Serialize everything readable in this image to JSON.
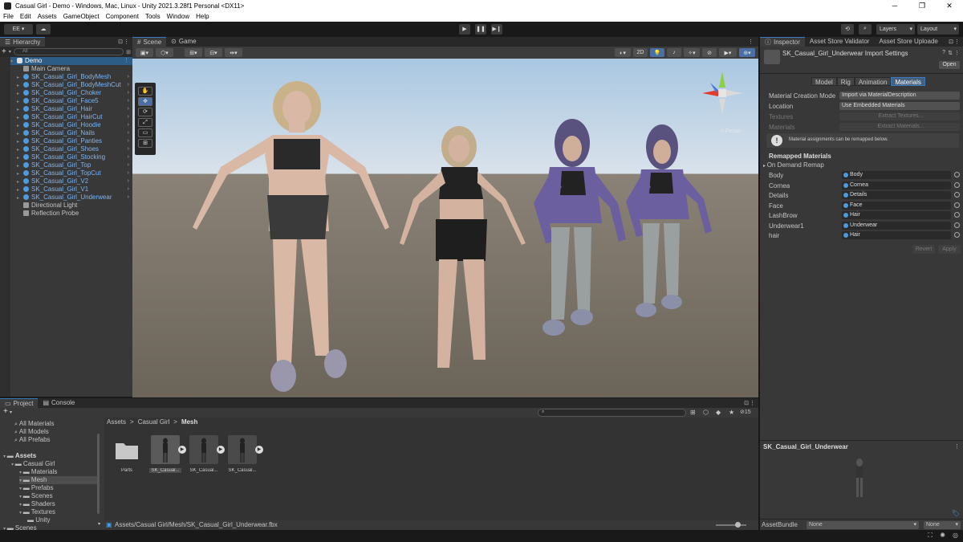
{
  "window": {
    "title": "Casual Girl - Demo - Windows, Mac, Linux - Unity 2021.3.28f1 Personal <DX11>",
    "controls": [
      "─",
      "❐",
      "✕"
    ]
  },
  "menu": [
    "File",
    "Edit",
    "Assets",
    "GameObject",
    "Component",
    "Tools",
    "Window",
    "Help"
  ],
  "toolbar": {
    "account": "EE ▾",
    "play": "▶",
    "pause": "❚❚",
    "step": "▶❙",
    "layers": "Layers",
    "layout": "Layout"
  },
  "hierarchy": {
    "tab": "Hierarchy",
    "search_placeholder": "All",
    "scene": "Demo",
    "items": [
      {
        "label": "Main Camera",
        "blue": false,
        "expand": false
      },
      {
        "label": "SK_Casual_Girl_BodyMesh",
        "blue": true,
        "expand": true
      },
      {
        "label": "SK_Casual_Girl_BodyMeshCut",
        "blue": true,
        "expand": true
      },
      {
        "label": "SK_Casual_Girl_Choker",
        "blue": true,
        "expand": true
      },
      {
        "label": "SK_Casual_Girl_Face5",
        "blue": true,
        "expand": true
      },
      {
        "label": "SK_Casual_Girl_Hair",
        "blue": true,
        "expand": true
      },
      {
        "label": "SK_Casual_Girl_HairCut",
        "blue": true,
        "expand": true
      },
      {
        "label": "SK_Casual_Girl_Hoodie",
        "blue": true,
        "expand": true
      },
      {
        "label": "SK_Casual_Girl_Nails",
        "blue": true,
        "expand": true
      },
      {
        "label": "SK_Casual_Girl_Panties",
        "blue": true,
        "expand": true
      },
      {
        "label": "SK_Casual_Girl_Shoes",
        "blue": true,
        "expand": true
      },
      {
        "label": "SK_Casual_Girl_Stocking",
        "blue": true,
        "expand": true
      },
      {
        "label": "SK_Casual_Girl_Top",
        "blue": true,
        "expand": true
      },
      {
        "label": "SK_Casual_Girl_TopCut",
        "blue": true,
        "expand": true
      },
      {
        "label": "SK_Casual_Girl_V2",
        "blue": true,
        "expand": true
      },
      {
        "label": "SK_Casual_Girl_V1",
        "blue": true,
        "expand": true
      },
      {
        "label": "SK_Casual_Girl_Underwear",
        "blue": true,
        "expand": true
      },
      {
        "label": "Directional Light",
        "blue": false,
        "expand": false
      },
      {
        "label": "Reflection Probe",
        "blue": false,
        "expand": false
      }
    ]
  },
  "scene": {
    "tabs": [
      "Scene",
      "Game"
    ],
    "mode_2d": "2D",
    "persp": "< Persp"
  },
  "inspector": {
    "tabs": [
      "Inspector",
      "Asset Store Validator",
      "Asset Store Uploade"
    ],
    "title": "SK_Casual_Girl_Underwear Import Settings",
    "open": "Open",
    "subtabs": [
      "Model",
      "Rig",
      "Animation",
      "Materials"
    ],
    "fields": [
      {
        "k": "Material Creation Mode",
        "v": "Import via MaterialDescription",
        "dim": false
      },
      {
        "k": "Location",
        "v": "Use Embedded Materials",
        "dim": false
      },
      {
        "k": "Textures",
        "v": "Extract Textures...",
        "dim": true
      },
      {
        "k": "Materials",
        "v": "Extract Materials...",
        "dim": true
      }
    ],
    "note": "Material assignments can be remapped below.",
    "remapped_header": "Remapped Materials",
    "on_demand": "On Demand Remap",
    "materials": [
      {
        "k": "Body",
        "v": "Body"
      },
      {
        "k": "Cornea",
        "v": "Cornea"
      },
      {
        "k": "Details",
        "v": "Details"
      },
      {
        "k": "Face",
        "v": "Face"
      },
      {
        "k": "LashBrow",
        "v": "Hair"
      },
      {
        "k": "Underwear1",
        "v": "Underwear"
      },
      {
        "k": "hair",
        "v": "Hair"
      }
    ],
    "revert": "Revert",
    "apply": "Apply",
    "preview_title": "SK_Casual_Girl_Underwear",
    "assetbundle_label": "AssetBundle",
    "assetbundle_value": "None",
    "assetbundle_variant": "None"
  },
  "project": {
    "tabs": [
      "Project",
      "Console"
    ],
    "favorites": [
      "All Materials",
      "All Models",
      "All Prefabs"
    ],
    "tree": [
      {
        "label": "Assets",
        "bold": true,
        "indent": 0
      },
      {
        "label": "Casual Girl",
        "bold": false,
        "indent": 1
      },
      {
        "label": "Materials",
        "bold": false,
        "indent": 2
      },
      {
        "label": "Mesh",
        "bold": false,
        "indent": 2,
        "selected": true
      },
      {
        "label": "Prefabs",
        "bold": false,
        "indent": 2
      },
      {
        "label": "Scenes",
        "bold": false,
        "indent": 2
      },
      {
        "label": "Shaders",
        "bold": false,
        "indent": 2
      },
      {
        "label": "Textures",
        "bold": false,
        "indent": 2
      },
      {
        "label": "Unity",
        "bold": false,
        "indent": 3
      },
      {
        "label": "Scenes",
        "bold": false,
        "indent": 0
      }
    ],
    "breadcrumb": [
      "Assets",
      ">",
      "Casual Girl",
      ">",
      "Mesh"
    ],
    "assets": [
      {
        "label": "Parts",
        "folder": true
      },
      {
        "label": "SK_Casual...",
        "folder": false,
        "selected": true
      },
      {
        "label": "SK_Casual...",
        "folder": false
      },
      {
        "label": "SK_Casual...",
        "folder": false
      }
    ],
    "count": "15",
    "path": "Assets/Casual Girl/Mesh/SK_Casual_Girl_Underwear.fbx"
  },
  "colors": {
    "accent": "#3a79bb",
    "prefab_blue": "#7bb5f5"
  }
}
